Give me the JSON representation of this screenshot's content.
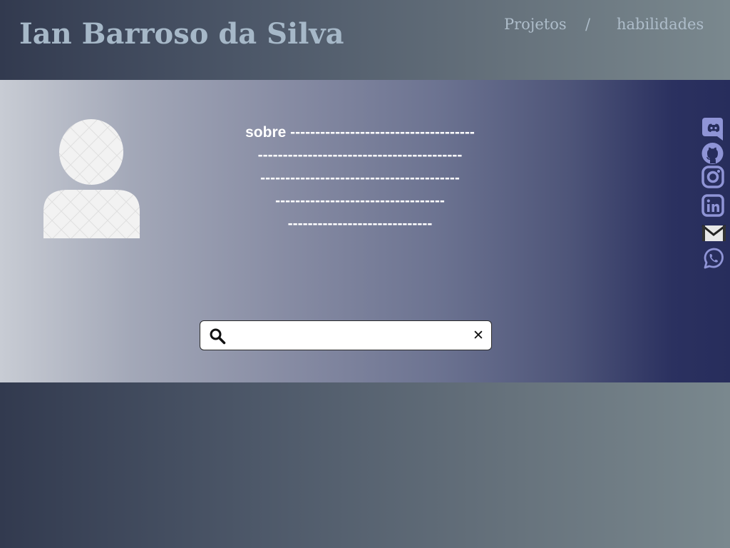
{
  "header": {
    "title": "Ian Barroso da Silva",
    "nav": {
      "projects": "Projetos",
      "separator": "/",
      "skills": "habilidades"
    }
  },
  "about": {
    "lines": [
      "sobre -------------------------------------",
      "-----------------------------------------",
      "----------------------------------------",
      "----------------------------------",
      "-----------------------------"
    ]
  },
  "search": {
    "value": "",
    "placeholder": "",
    "clear_label": "✕"
  },
  "socials": [
    "discord-icon",
    "github-icon",
    "instagram-icon",
    "linkedin-icon",
    "email-icon",
    "whatsapp-icon"
  ],
  "colors": {
    "title": "#a6b8c8",
    "social_icon": "#8f94d6",
    "hero_end": "#272d5c"
  }
}
